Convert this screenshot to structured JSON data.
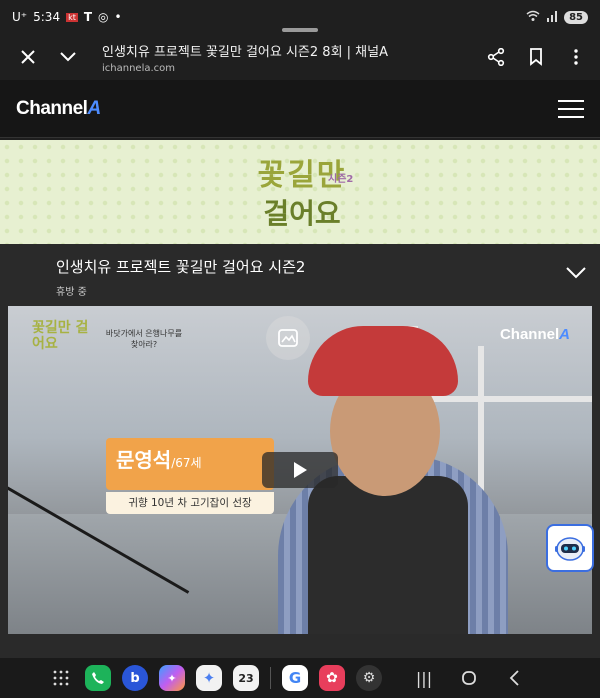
{
  "status_bar": {
    "carrier": "U⁺",
    "time": "5:34",
    "icons": [
      "kt-icon",
      "t-icon",
      "instagram-icon",
      "dot-icon"
    ],
    "battery": "85"
  },
  "browser": {
    "page_title": "인생치유 프로젝트 꽃길만 걸어요 시즌2 8회 | 채널A",
    "domain": "ichannela.com"
  },
  "site": {
    "logo_text": "Channel",
    "logo_mark": "A"
  },
  "banner": {
    "title_line1": "꽃길만",
    "title_line2": "걸어요",
    "season_tag": "시즌2"
  },
  "program": {
    "title": "인생치유 프로젝트 꽃길만 걸어요 시즌2",
    "status": "휴방 중"
  },
  "player": {
    "corner_title": "꽃길만 걸어요",
    "corner_sub": "바닷가에서 은행나무를 찾아라?",
    "logo_text": "Channel",
    "logo_mark": "A",
    "caption_name": "문영석",
    "caption_age": "/67세",
    "caption_desc": "귀향 10년 차 고기잡이 선장"
  },
  "nav": {
    "calendar_day": "23"
  },
  "colors": {
    "accent": "#4d8cff",
    "caption_orange": "#f1a34a",
    "banner_bg": "#e7f0d1"
  }
}
